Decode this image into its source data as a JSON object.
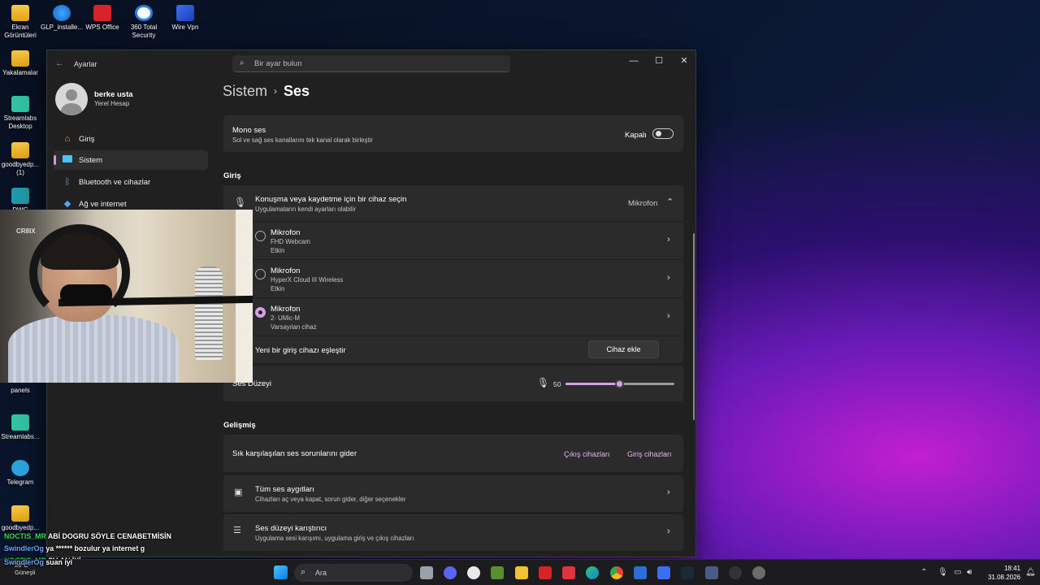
{
  "desktop": {
    "icons": [
      {
        "label": "Ekran Görüntüleri",
        "icon": "folder-icon"
      },
      {
        "label": "GLP_installe...",
        "icon": "installer-icon"
      },
      {
        "label": "WPS Office",
        "icon": "wps-icon"
      },
      {
        "label": "360 Total Security",
        "icon": "security-icon"
      },
      {
        "label": "Wire Vpn",
        "icon": "vpn-icon"
      },
      {
        "label": "Yakalamalar",
        "icon": "folder-icon"
      },
      {
        "label": "Streamlabs Desktop",
        "icon": "streamlabs-icon"
      },
      {
        "label": "goodbyedp... (1)",
        "icon": "folder-icon"
      },
      {
        "label": "DWG",
        "icon": "dwg-icon"
      },
      {
        "label": "panels",
        "icon": "panels-icon"
      },
      {
        "label": "Streamlabs...",
        "icon": "streamlabs-icon"
      },
      {
        "label": "Telegram",
        "icon": "telegram-icon"
      },
      {
        "label": "goodbyedp...",
        "icon": "folder-icon"
      }
    ]
  },
  "window": {
    "app_title": "Ayarlar",
    "search_placeholder": "Bir ayar bulun",
    "controls": {
      "minimize": "—",
      "maximize": "☐",
      "close": "✕"
    }
  },
  "user": {
    "name": "berke usta",
    "type": "Yerel Hesap"
  },
  "sidebar": {
    "items": [
      {
        "label": "Giriş",
        "icon": "home-icon"
      },
      {
        "label": "Sistem",
        "icon": "system-icon",
        "active": true
      },
      {
        "label": "Bluetooth ve cihazlar",
        "icon": "bluetooth-icon"
      },
      {
        "label": "Ağ ve internet",
        "icon": "network-icon"
      }
    ]
  },
  "breadcrumb": {
    "parent": "Sistem",
    "separator": "›",
    "current": "Ses"
  },
  "mono": {
    "title": "Mono ses",
    "subtitle": "Sol ve sağ ses kanallarını tek kanal olarak birleştir",
    "state_label": "Kapalı",
    "on": false
  },
  "input_section": {
    "heading": "Giriş",
    "device_select": {
      "title": "Konuşma veya kaydetme için bir cihaz seçin",
      "subtitle": "Uygulamaların kendi ayarları olabilir",
      "value": "Mikrofon"
    },
    "devices": [
      {
        "name": "Mikrofon",
        "model": "FHD Webcam",
        "status": "Etkin",
        "selected": false
      },
      {
        "name": "Mikrofon",
        "model": "HyperX Cloud III Wireless",
        "status": "Etkin",
        "selected": false
      },
      {
        "name": "Mikrofon",
        "model": "2- UMic-M",
        "status": "Varsayılan cihaz",
        "selected": true
      }
    ],
    "pair": {
      "label": "Yeni bir giriş cihazı eşleştir",
      "button": "Cihaz ekle"
    },
    "volume": {
      "label": "Ses Düzeyi",
      "value": "50",
      "level": 0.5
    }
  },
  "advanced": {
    "heading": "Gelişmiş",
    "troubleshoot": {
      "label": "Sık karşılaşılan ses sorunlarını gider",
      "link_out": "Çıkış cihazları",
      "link_in": "Giriş cihazları"
    },
    "all_devices": {
      "title": "Tüm ses aygıtları",
      "subtitle": "Cihazları aç veya kapat, sorun gider, diğer seçenekler"
    },
    "mixer": {
      "title": "Ses düzeyi karıştırıcı",
      "subtitle": "Uygulama sesi karışımı, uygulama giriş ve çıkış cihazları"
    }
  },
  "chat": [
    {
      "nick": "NOCTIS_MR",
      "text": "ABİ DOGRU SÖYLE CENABETMİSİN",
      "color": "#3ddc56"
    },
    {
      "nick": "SwindlerOg",
      "text": "ya ****** bozulur ya internet g",
      "color": "#6aa7ff"
    },
    {
      "nick": "NOCTIS_MR",
      "text": "ŞU AN İYİ",
      "color": "#3ddc56"
    },
    {
      "nick": "SwindlerOg",
      "text": "suan iyi",
      "color": "#6aa7ff"
    }
  ],
  "webcam": {
    "overlay_text": "CR8IX"
  },
  "taskbar": {
    "search_label": "Ara",
    "weather_temp": "26°C",
    "weather_text": "Güneşli",
    "clock_time": "18:41",
    "clock_date": "31.08.2026"
  },
  "accent_color": "#d69fe8"
}
